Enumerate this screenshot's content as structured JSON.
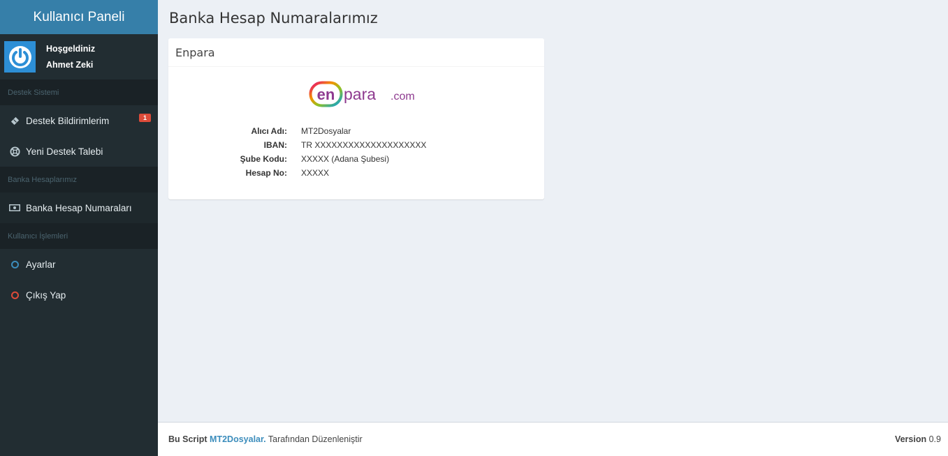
{
  "brand": "Kullanıcı Paneli",
  "user": {
    "greeting": "Hoşgeldiniz",
    "name": "Ahmet Zeki"
  },
  "sidebar": {
    "sections": [
      {
        "header": "Destek Sistemi"
      },
      {
        "header": "Banka Hesaplarımız"
      },
      {
        "header": "Kullanıcı İşlemleri"
      }
    ],
    "items": [
      {
        "label": "Destek Bildirimlerim",
        "icon": "ticket-icon",
        "badge": "1"
      },
      {
        "label": "Yeni Destek Talebi",
        "icon": "life-ring-icon"
      },
      {
        "label": "Banka Hesap Numaraları",
        "icon": "money-icon"
      },
      {
        "label": "Ayarlar",
        "icon": "circle-blue-icon"
      },
      {
        "label": "Çıkış Yap",
        "icon": "circle-red-icon"
      }
    ]
  },
  "page": {
    "title": "Banka Hesap Numaralarımız"
  },
  "bank": {
    "title": "Enpara",
    "logo_text": {
      "en": "en",
      "para": "para",
      "com": ".com"
    },
    "fields": [
      {
        "key": "Alıcı Adı:",
        "value": "MT2Dosyalar"
      },
      {
        "key": "IBAN:",
        "value": "TR XXXXXXXXXXXXXXXXXXXX"
      },
      {
        "key": "Şube Kodu:",
        "value": "XXXXX (Adana Şubesi)"
      },
      {
        "key": "Hesap No:",
        "value": "XXXXX"
      }
    ]
  },
  "footer": {
    "prefix": "Bu Script",
    "link": "MT2Dosyalar.",
    "suffix": "Tarafından Düzenleniştir",
    "version_label": "Version",
    "version": "0.9"
  },
  "colors": {
    "accent": "#3c8dbc",
    "badge": "#dd4b39",
    "sidebar": "#222d32"
  }
}
